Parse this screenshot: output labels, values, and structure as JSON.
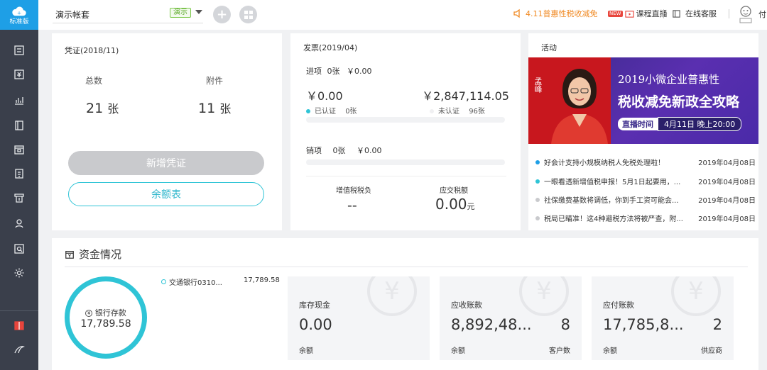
{
  "sidebar": {
    "logo_label": "标准版"
  },
  "topbar": {
    "account_name": "演示帐套",
    "demo_badge": "演示",
    "promo_text": "4.11普惠性税收减免",
    "new_badge": "NEW",
    "live_label": "课程直播",
    "cs_label": "在线客服",
    "pay_label": "付"
  },
  "voucher": {
    "title": "凭证(2018/11)",
    "total_label": "总数",
    "total_value": "21",
    "total_unit": "张",
    "attach_label": "附件",
    "attach_value": "11",
    "attach_unit": "张",
    "add_button": "新增凭证",
    "balance_button": "余额表"
  },
  "invoice": {
    "title": "发票(2019/04)",
    "input_label": "进项",
    "input_count": "0张",
    "input_amount": "￥0.00",
    "certified_amount": "￥0.00",
    "certified_label": "已认证",
    "certified_count": "0张",
    "uncertified_amount": "￥2,847,114.05",
    "uncertified_label": "未认证",
    "uncertified_count": "96张",
    "output_label": "销项",
    "output_count": "0张",
    "output_amount": "￥0.00",
    "vat_label": "增值税税负",
    "vat_value": "--",
    "tax_label": "应交税额",
    "tax_value": "0.00",
    "tax_unit": "元"
  },
  "activity": {
    "title": "活动",
    "banner": {
      "year_title": "2019小微企业普惠性",
      "headline": "税收减免新政全攻略",
      "presenter": "孟峰",
      "live_tag": "直播时间",
      "live_time": "4月11日 晚上20:00"
    },
    "news": [
      {
        "text": "好会计支持小规模纳税人免税处理啦！",
        "date": "2019年04月08日",
        "color": "#1e9fe6"
      },
      {
        "text": "一眼看透新增值税申报！5月1日起要用，...",
        "date": "2019年04月08日",
        "color": "#2fc4d6"
      },
      {
        "text": "社保缴费基数将调低，你到手工资可能会...",
        "date": "2019年04月08日",
        "color": "#c9cacd"
      },
      {
        "text": "税局已瞄准！这4种避税方法将被严查，附...",
        "date": "2019年04月08日",
        "color": "#c9cacd"
      }
    ]
  },
  "funds": {
    "title": "资金情况",
    "ring_label": "银行存款",
    "ring_value": "17,789.58",
    "bank_name": "交通银行0310...",
    "bank_amount": "17,789.58",
    "tiles": [
      {
        "label": "库存现金",
        "value": "0.00",
        "sub": "余额",
        "count": "",
        "count_label": ""
      },
      {
        "label": "应收账款",
        "value": "8,892,48...",
        "sub": "余额",
        "count": "8",
        "count_label": "客户数"
      },
      {
        "label": "应付账款",
        "value": "17,785,8...",
        "sub": "余额",
        "count": "2",
        "count_label": "供应商"
      }
    ]
  },
  "colors": {
    "brand": "#1e9fe6",
    "teal": "#2fc4d6",
    "sidebar": "#3a3f4b",
    "promo": "#f08a24"
  }
}
